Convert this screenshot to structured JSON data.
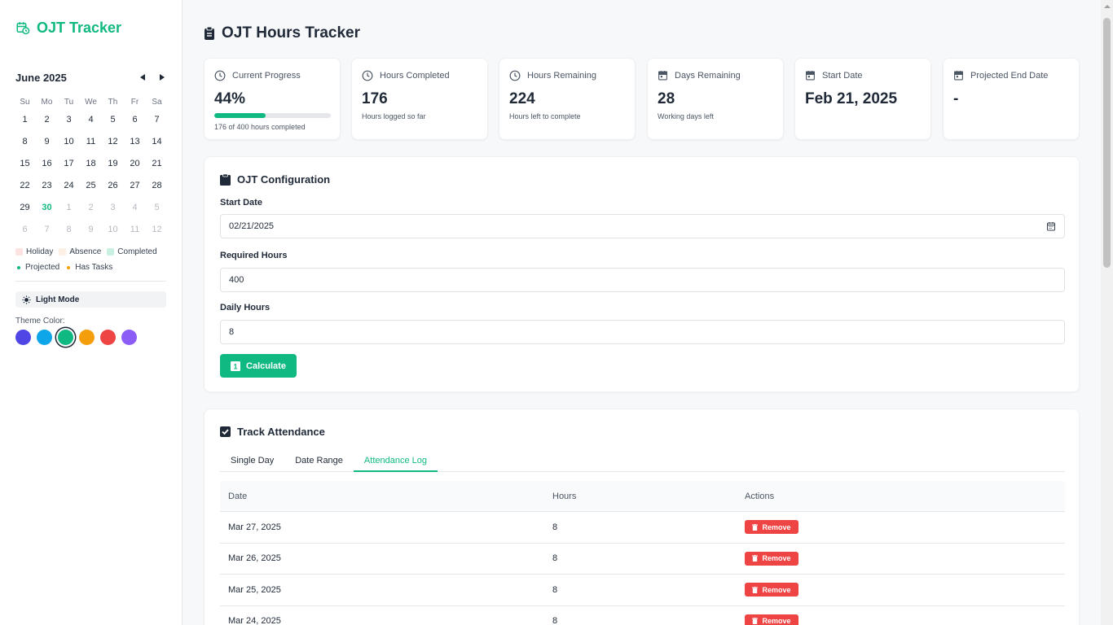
{
  "app": {
    "brand": "OJT Tracker",
    "page_title": "OJT Hours Tracker",
    "accent": "#10b981"
  },
  "calendar": {
    "month_label": "June 2025",
    "weekdays": [
      "Su",
      "Mo",
      "Tu",
      "We",
      "Th",
      "Fr",
      "Sa"
    ],
    "weeks": [
      [
        "1",
        "2",
        "3",
        "4",
        "5",
        "6",
        "7"
      ],
      [
        "8",
        "9",
        "10",
        "11",
        "12",
        "13",
        "14"
      ],
      [
        "15",
        "16",
        "17",
        "18",
        "19",
        "20",
        "21"
      ],
      [
        "22",
        "23",
        "24",
        "25",
        "26",
        "27",
        "28"
      ],
      [
        "29",
        "30",
        "1",
        "2",
        "3",
        "4",
        "5"
      ],
      [
        "6",
        "7",
        "8",
        "9",
        "10",
        "11",
        "12"
      ]
    ],
    "today": "30",
    "legend": {
      "holiday": "Holiday",
      "absence": "Absence",
      "completed": "Completed",
      "projected": "Projected",
      "has_tasks": "Has Tasks"
    }
  },
  "sidebar": {
    "mode_label": "Light Mode",
    "theme_label": "Theme Color:",
    "theme_colors": [
      "#4f46e5",
      "#0ea5e9",
      "#10b981",
      "#f59e0b",
      "#ef4444",
      "#8b5cf6"
    ],
    "selected_theme": "#10b981"
  },
  "stats": {
    "progress": {
      "label": "Current Progress",
      "value": "44%",
      "fraction": 0.44,
      "sub": "176 of 400 hours completed"
    },
    "completed": {
      "label": "Hours Completed",
      "value": "176",
      "sub": "Hours logged so far"
    },
    "remaining": {
      "label": "Hours Remaining",
      "value": "224",
      "sub": "Hours left to complete"
    },
    "days": {
      "label": "Days Remaining",
      "value": "28",
      "sub": "Working days left"
    },
    "start": {
      "label": "Start Date",
      "value": "Feb 21, 2025"
    },
    "end": {
      "label": "Projected End Date",
      "value": "-"
    }
  },
  "config": {
    "title": "OJT Configuration",
    "start_label": "Start Date",
    "start_value": "02/21/2025",
    "required_label": "Required Hours",
    "required_value": "400",
    "daily_label": "Daily Hours",
    "daily_value": "8",
    "calc_label": "Calculate"
  },
  "attendance": {
    "title": "Track Attendance",
    "tabs": [
      "Single Day",
      "Date Range",
      "Attendance Log"
    ],
    "active_tab": "Attendance Log",
    "columns": [
      "Date",
      "Hours",
      "Actions"
    ],
    "remove_label": "Remove",
    "rows": [
      {
        "date": "Mar 27, 2025",
        "hours": "8"
      },
      {
        "date": "Mar 26, 2025",
        "hours": "8"
      },
      {
        "date": "Mar 25, 2025",
        "hours": "8"
      },
      {
        "date": "Mar 24, 2025",
        "hours": "8"
      }
    ]
  }
}
